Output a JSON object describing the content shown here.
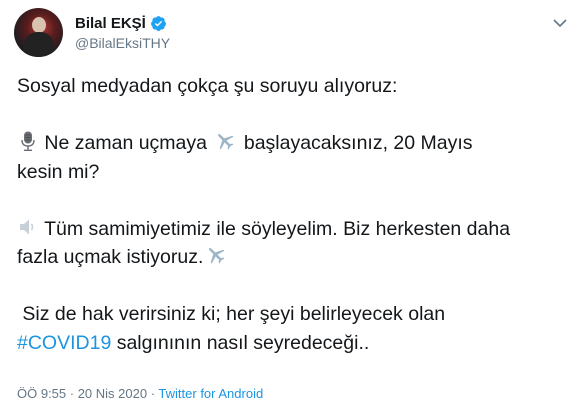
{
  "author": {
    "display_name": "Bilal EKŞİ",
    "handle": "@BilalEksiTHY"
  },
  "tweet": {
    "line1": "Sosyal medyadan çokça şu soruyu alıyoruz:",
    "line2a": "Ne zaman uçmaya",
    "line2b": "başlayacaksınız, 20 Mayıs",
    "line3": "kesin mi?",
    "line4": "Tüm samimiyetimiz ile söyleyelim. Biz herkesten daha",
    "line5": "fazla uçmak istiyoruz.",
    "line6": " Siz de hak verirsiniz ki; her şeyi belirleyecek olan",
    "hashtag": "#COVID19",
    "line7_rest": " salgınının nasıl seyredeceği.."
  },
  "meta": {
    "time": "ÖÖ 9:55",
    "separator": " · ",
    "date": "20 Nis 2020",
    "source": "Twitter for Android"
  },
  "icons": {
    "microphone": "microphone-icon",
    "airplane": "airplane-icon",
    "speaker": "speaker-icon",
    "verified": "verified-badge-icon",
    "caret": "chevron-down-icon"
  },
  "colors": {
    "link": "#1b95e0",
    "verified": "#1da1f2",
    "muted": "#657786",
    "text": "#14171a"
  }
}
